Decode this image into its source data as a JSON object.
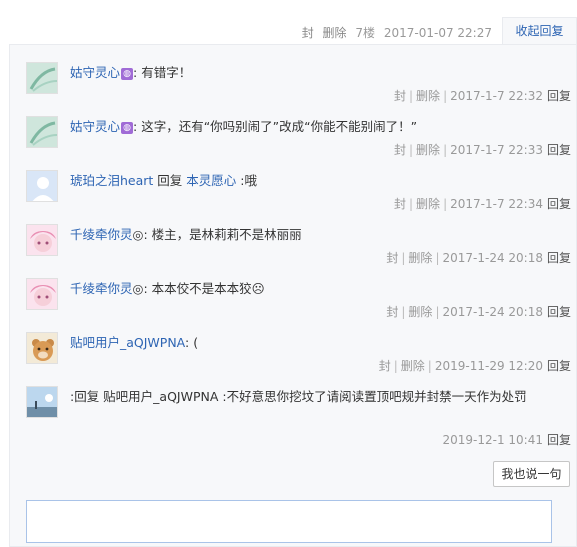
{
  "header": {
    "ban": "封",
    "delete": "删除",
    "floor": "7楼",
    "datetime": "2017-01-07 22:27",
    "collapse": "收起回复"
  },
  "replies": [
    {
      "user": "姑守灵心",
      "badge": true,
      "sep": ":",
      "text": " 有错字！",
      "info": {
        "ban": "封",
        "delete": "删除",
        "time": "2017-1-7 22:32",
        "reply": "回复"
      }
    },
    {
      "user": "姑守灵心",
      "badge": true,
      "sep": ":",
      "text": " 这字，还有“你吗别闹了”改成“你能不能别闹了！”",
      "info": {
        "ban": "封",
        "delete": "删除",
        "time": "2017-1-7 22:33",
        "reply": "回复"
      }
    },
    {
      "user": "琥珀之泪heart",
      "badge": false,
      "sep": ":",
      "text": " 回复 ",
      "target": "本灵愿心",
      "text2": " :哦",
      "info": {
        "ban": "封",
        "delete": "删除",
        "time": "2017-1-7 22:34",
        "reply": "回复"
      }
    },
    {
      "user": "千绫牵你灵",
      "badge": false,
      "mark": "◎",
      "sep": ":",
      "text": " 楼主，是林莉莉不是林丽丽",
      "info": {
        "ban": "封",
        "delete": "删除",
        "time": "2017-1-24 20:18",
        "reply": "回复"
      }
    },
    {
      "user": "千绫牵你灵",
      "badge": false,
      "mark": "◎",
      "sep": ":",
      "text": " 本本佼不是本本狡☹",
      "info": {
        "ban": "封",
        "delete": "删除",
        "time": "2017-1-24 20:18",
        "reply": "回复"
      }
    },
    {
      "user": "贴吧用户_aQJWPNA",
      "badge": false,
      "sep": ":",
      "text": " (",
      "info": {
        "ban": "封",
        "delete": "删除",
        "time": "2019-11-29 12:20",
        "reply": "回复"
      }
    },
    {
      "user": "",
      "badge": false,
      "sep": "",
      "text": ":回复 贴吧用户_aQJWPNA :不好意思你挖坟了请阅读置顶吧规并封禁一天作为处罚",
      "info": {
        "ban": "",
        "delete": "",
        "time": "2019-12-1 10:41",
        "reply": "回复"
      }
    }
  ],
  "footer": {
    "say_button": "我也说一句",
    "input_placeholder": ""
  },
  "colors": {
    "link": "#2d64b3",
    "badge": "#a06bd6",
    "panel_bg": "#f7f8fa"
  }
}
